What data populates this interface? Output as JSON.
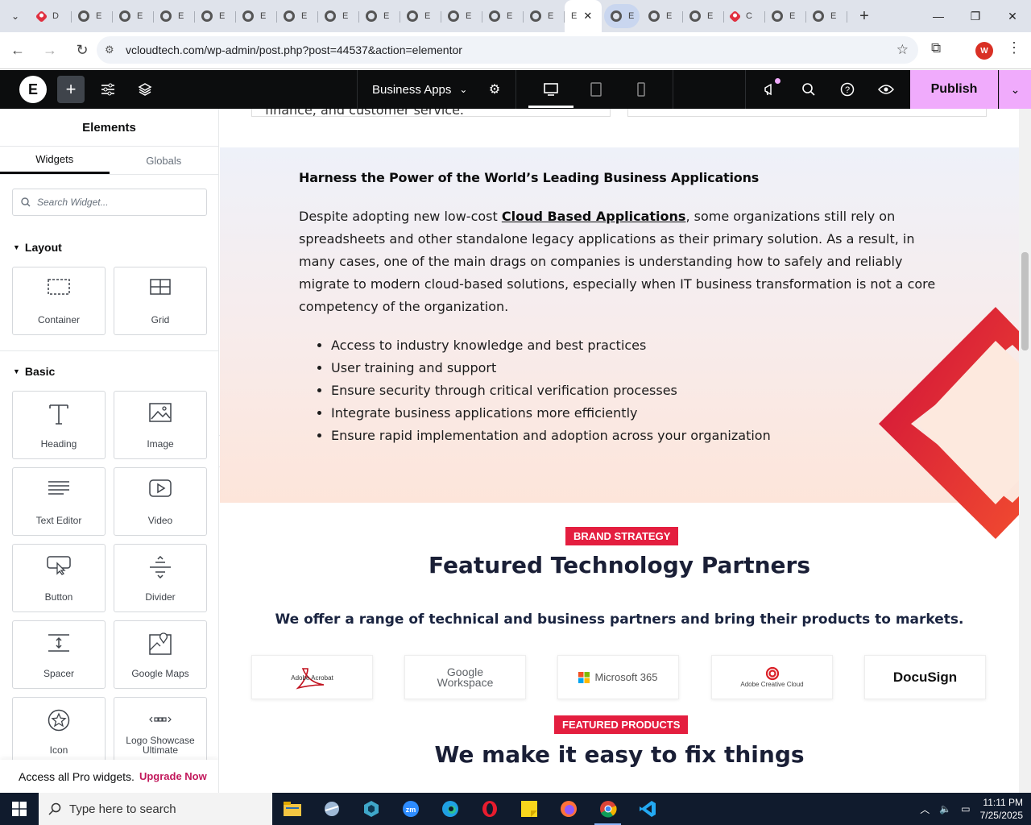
{
  "browser": {
    "tabs": [
      {
        "title": "D",
        "icon": "red"
      },
      {
        "title": "E",
        "icon": "globe"
      },
      {
        "title": "E",
        "icon": "globe"
      },
      {
        "title": "E",
        "icon": "globe"
      },
      {
        "title": "E",
        "icon": "globe"
      },
      {
        "title": "E",
        "icon": "globe"
      },
      {
        "title": "E",
        "icon": "globe"
      },
      {
        "title": "E",
        "icon": "globe"
      },
      {
        "title": "E",
        "icon": "globe"
      },
      {
        "title": "E",
        "icon": "globe"
      },
      {
        "title": "E",
        "icon": "globe"
      },
      {
        "title": "E",
        "icon": "globe"
      },
      {
        "title": "E",
        "icon": "globe"
      }
    ],
    "active_tab_title": "E",
    "tabs_after": [
      {
        "title": "E",
        "icon": "globe",
        "highlight": true
      },
      {
        "title": "E",
        "icon": "globe"
      },
      {
        "title": "E",
        "icon": "globe"
      },
      {
        "title": "C",
        "icon": "red"
      },
      {
        "title": "E",
        "icon": "globe"
      },
      {
        "title": "E",
        "icon": "globe"
      }
    ],
    "url": "vcloudtech.com/wp-admin/post.php?post=44537&action=elementor",
    "profile_initial": "W"
  },
  "editor": {
    "page_title": "Business Apps",
    "publish_label": "Publish"
  },
  "panel": {
    "title": "Elements",
    "tabs": [
      "Widgets",
      "Globals"
    ],
    "search_placeholder": "Search Widget...",
    "layout_label": "Layout",
    "basic_label": "Basic",
    "layout_widgets": [
      "Container",
      "Grid"
    ],
    "basic_widgets": [
      "Heading",
      "Image",
      "Text Editor",
      "Video",
      "Button",
      "Divider",
      "Spacer",
      "Google Maps",
      "Icon",
      "Logo Showcase Ultimate"
    ],
    "promo_text": "Access all Pro widgets.",
    "promo_link": "Upgrade Now"
  },
  "content": {
    "prev_text": "finance, and customer service.",
    "hero_heading": "Harness the Power of the World’s Leading Business Applications",
    "para_before": "Despite adopting new low-cost ",
    "para_link": "Cloud Based Applications",
    "para_after": ", some organizations still rely on spreadsheets and other standalone legacy applications as their primary solution. As a result, in many cases, one of the main drags on companies is understanding how to safely and reliably migrate to modern cloud-based solutions, especially when IT business transformation is not a core competency of the organization.",
    "bullets": [
      "Access to industry knowledge and best practices",
      "User training and support",
      "Ensure security through critical verification processes",
      "Integrate business applications more efficiently",
      "Ensure rapid implementation and adoption across your organization"
    ],
    "badge1": "BRAND STRATEGY",
    "heading1": "Featured Technology Partners",
    "subheading": "We offer a range of technical and business partners and bring their products to markets.",
    "partners": [
      "Adobe Acrobat",
      "Google Workspace",
      "Microsoft 365",
      "Adobe Creative Cloud",
      "DocuSign"
    ],
    "badge2": "FEATURED PRODUCTS",
    "heading2": "We make it easy to fix things"
  },
  "taskbar": {
    "search_placeholder": "Type here to search",
    "time": "11:11 PM",
    "date": "7/25/2025"
  },
  "colors": {
    "accent_red": "#e41e3f",
    "publish_pink": "#f0abfc",
    "editor_dark": "#0c0d0e"
  }
}
